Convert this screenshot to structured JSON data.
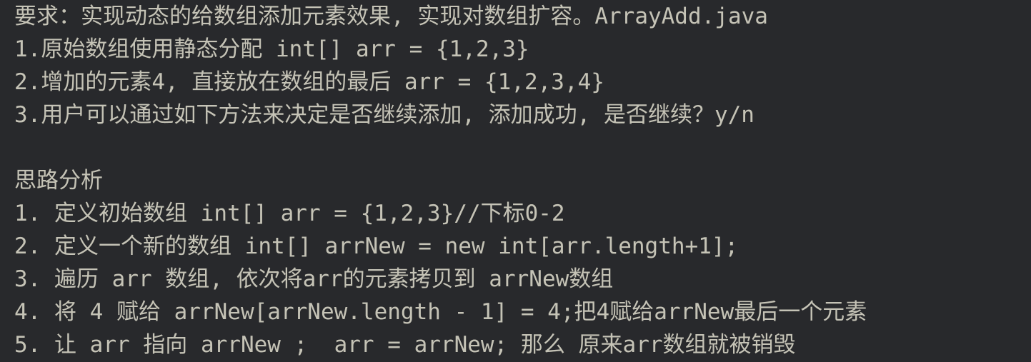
{
  "editor": {
    "lines": [
      "要求：实现动态的给数组添加元素效果, 实现对数组扩容。ArrayAdd.java",
      "1.原始数组使用静态分配 int[] arr = {1,2,3}",
      "2.增加的元素4, 直接放在数组的最后 arr = {1,2,3,4}",
      "3.用户可以通过如下方法来决定是否继续添加, 添加成功, 是否继续？y/n",
      "",
      "思路分析",
      "1. 定义初始数组 int[] arr = {1,2,3}//下标0-2",
      "2. 定义一个新的数组 int[] arrNew = new int[arr.length+1];",
      "3. 遍历 arr 数组, 依次将arr的元素拷贝到 arrNew数组",
      "4. 将 4 赋给 arrNew[arrNew.length - 1] = 4;把4赋给arrNew最后一个元素",
      "5. 让 arr 指向 arrNew ;  arr = arrNew; 那么 原来arr数组就被销毁"
    ]
  },
  "colors": {
    "background": "#28292c",
    "text": "#c5c3b6"
  }
}
